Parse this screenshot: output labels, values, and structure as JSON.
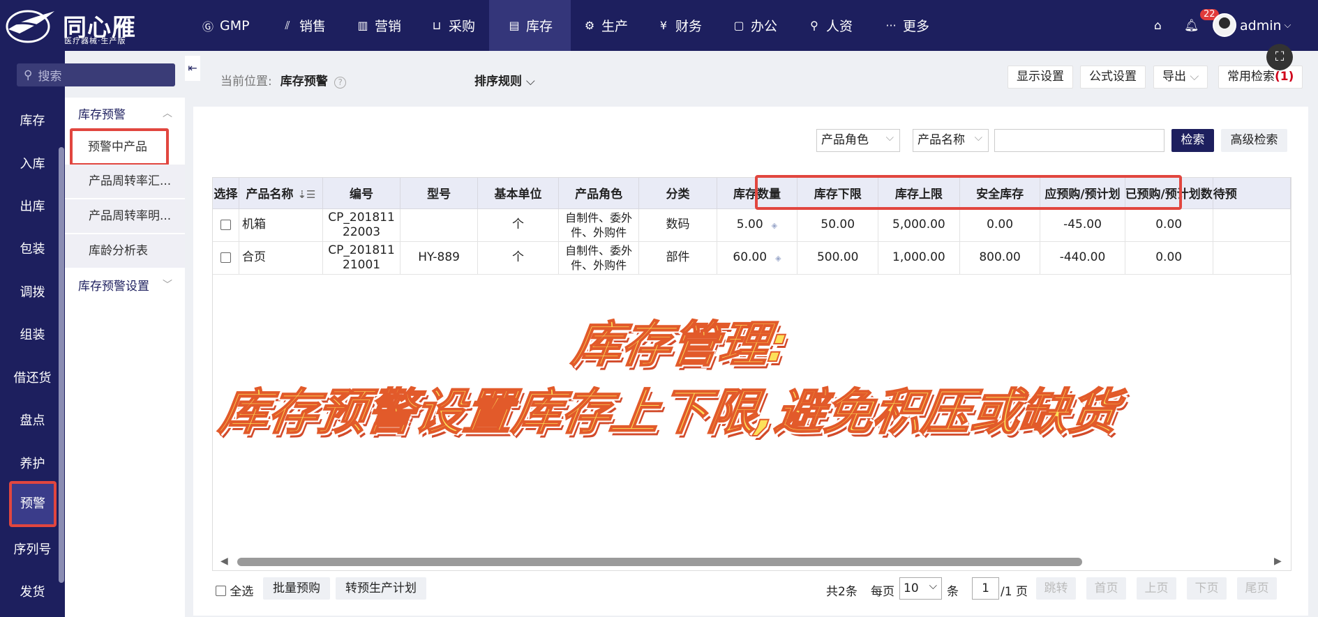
{
  "brand": {
    "name": "同心雁",
    "subtitle": "医疗器械·生产版"
  },
  "topnav": [
    {
      "key": "gmp",
      "label": "GMP",
      "icon": "gmp-icon",
      "glyph": "Ⓖ"
    },
    {
      "key": "sales",
      "label": "销售",
      "icon": "sales-chart-icon",
      "glyph": "📈"
    },
    {
      "key": "marketing",
      "label": "营销",
      "icon": "bar-chart-icon",
      "glyph": "▥"
    },
    {
      "key": "purchase",
      "label": "采购",
      "icon": "basket-icon",
      "glyph": "🧺"
    },
    {
      "key": "inventory",
      "label": "库存",
      "icon": "inventory-icon",
      "glyph": "▤",
      "active": true
    },
    {
      "key": "production",
      "label": "生产",
      "icon": "production-icon",
      "glyph": "⚙"
    },
    {
      "key": "finance",
      "label": "财务",
      "icon": "yen-icon",
      "glyph": "¥"
    },
    {
      "key": "office",
      "label": "办公",
      "icon": "briefcase-icon",
      "glyph": "💼"
    },
    {
      "key": "hr",
      "label": "人资",
      "icon": "person-icon",
      "glyph": "👤"
    },
    {
      "key": "more",
      "label": "更多",
      "icon": "more-icon",
      "glyph": "···"
    }
  ],
  "topright": {
    "notification_count": "22",
    "username": "admin"
  },
  "rail": {
    "search_placeholder": "搜索",
    "items": [
      "库存",
      "入库",
      "出库",
      "包装",
      "调拨",
      "组装",
      "借还货",
      "盘点",
      "养护",
      "预警",
      "序列号",
      "发货"
    ],
    "active": "预警"
  },
  "submenu": {
    "group1": "库存预警",
    "items": [
      "预警中产品",
      "产品周转率汇...",
      "产品周转率明...",
      "库龄分析表"
    ],
    "group2": "库存预警设置"
  },
  "header": {
    "crumb_label": "当前位置:",
    "crumb_value": "库存预警",
    "sort_label": "排序规则",
    "buttons": {
      "display": "显示设置",
      "formula": "公式设置",
      "export": "导出",
      "saved_search": "常用检索",
      "saved_search_count": "(1)"
    }
  },
  "filters": {
    "role_select": "产品角色",
    "field_select": "产品名称",
    "search_btn": "检索",
    "advanced_btn": "高级检索"
  },
  "table": {
    "columns": [
      "选择",
      "产品名称",
      "编号",
      "型号",
      "基本单位",
      "产品角色",
      "分类",
      "库存数量",
      "库存下限",
      "库存上限",
      "安全库存",
      "应预购/预计划",
      "已预购/预计划数",
      "待预"
    ],
    "rows": [
      {
        "name": "机箱",
        "code": "CP_20181122003",
        "model": "",
        "unit": "个",
        "role": "自制件、委外件、外购件",
        "category": "数码",
        "qty": "5.00",
        "min": "50.00",
        "max": "5,000.00",
        "safe": "0.00",
        "should": "-45.00",
        "done": "0.00"
      },
      {
        "name": "合页",
        "code": "CP_20181121001",
        "model": "HY-889",
        "unit": "个",
        "role": "自制件、委外件、外购件",
        "category": "部件",
        "qty": "60.00",
        "min": "500.00",
        "max": "1,000.00",
        "safe": "800.00",
        "should": "-440.00",
        "done": "0.00"
      }
    ]
  },
  "caption": {
    "line1": "库存管理:",
    "line2": "库存预警设置库存上下限,避免积压或缺货"
  },
  "footer": {
    "select_all": "全选",
    "batch_btn": "批量预购",
    "plan_btn": "转预生产计划",
    "total": "共2条",
    "per_page_label": "每页",
    "per_page": "10",
    "per_page_unit": "条",
    "page": "1",
    "page_total": "/1 页",
    "jump": "跳转",
    "first": "首页",
    "prev": "上页",
    "next": "下页",
    "last": "尾页"
  }
}
